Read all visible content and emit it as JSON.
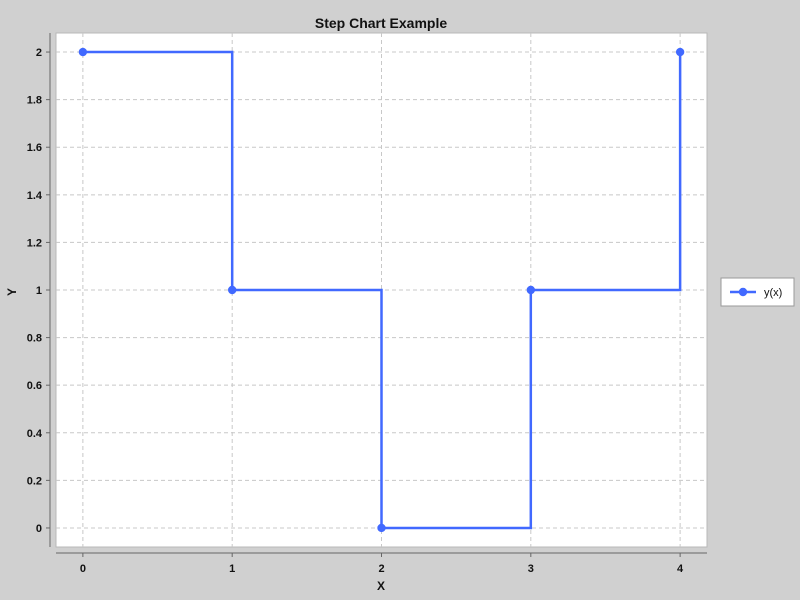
{
  "chart_data": {
    "type": "line",
    "step": true,
    "title": "Step Chart Example",
    "xlabel": "X",
    "ylabel": "Y",
    "xlim": [
      -0.18,
      4.18
    ],
    "ylim": [
      -0.08,
      2.08
    ],
    "x_ticks": [
      0,
      1,
      2,
      3,
      4
    ],
    "y_ticks": [
      0,
      0.2,
      0.4,
      0.6,
      0.8,
      1,
      1.2,
      1.4,
      1.6,
      1.8,
      2
    ],
    "grid": true,
    "legend": "right",
    "series": [
      {
        "name": "y(x)",
        "color": "#4169ff",
        "x": [
          0,
          1,
          2,
          3,
          4
        ],
        "y": [
          2,
          1,
          0,
          1,
          2
        ]
      }
    ]
  },
  "colors": {
    "background": "#d0d0d0",
    "plot_background": "#ffffff",
    "grid": "#c8c8c8",
    "axis": "#666666"
  }
}
